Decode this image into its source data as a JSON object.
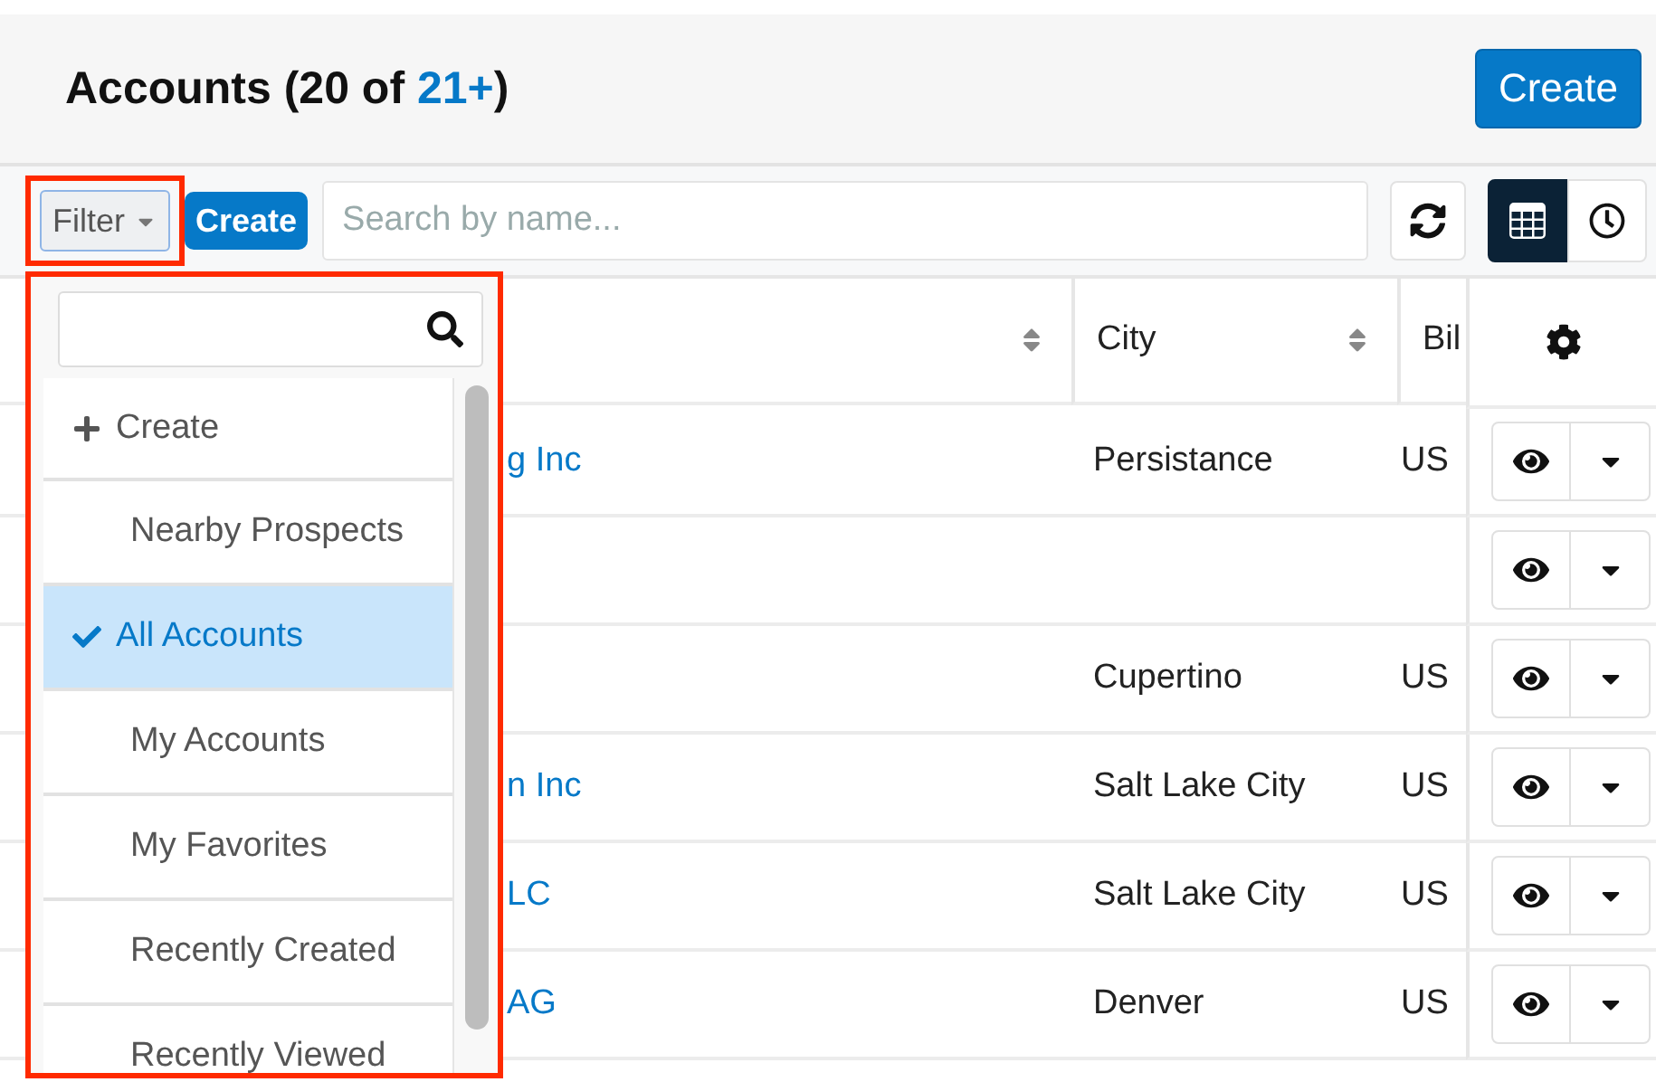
{
  "header": {
    "title_prefix": "Accounts (20 of ",
    "count_link": "21+",
    "title_suffix": ")",
    "create_button": "Create"
  },
  "toolbar": {
    "filter_button": "Filter",
    "filter_highlighted": true,
    "create_button": "Create",
    "search": {
      "placeholder": "Search by name..."
    },
    "views": [
      {
        "kind": "list",
        "selected": true
      },
      {
        "kind": "timeline",
        "selected": false
      }
    ]
  },
  "filter_menu": {
    "highlighted": true,
    "items": [
      {
        "kind": "action",
        "label": "Create",
        "selected": false
      },
      {
        "kind": "filter",
        "label": "Nearby Prospects",
        "selected": false
      },
      {
        "kind": "filter",
        "label": "All Accounts",
        "selected": true
      },
      {
        "kind": "filter",
        "label": "My Accounts",
        "selected": false
      },
      {
        "kind": "filter",
        "label": "My Favorites",
        "selected": false
      },
      {
        "kind": "filter",
        "label": "Recently Created",
        "selected": false
      },
      {
        "kind": "filter",
        "label": "Recently Viewed",
        "selected": false
      }
    ]
  },
  "table": {
    "columns": [
      {
        "sortable": true
      },
      {
        "label": "City",
        "sortable": true
      },
      {
        "label": "Bil"
      }
    ],
    "rows": [
      {
        "name": "g Inc",
        "city": "Persistance",
        "billing": "US"
      },
      {},
      {
        "city": "Cupertino",
        "billing": "US"
      },
      {
        "name": "n Inc",
        "city": "Salt Lake City",
        "billing": "US"
      },
      {
        "name": "LC",
        "city": "Salt Lake City",
        "billing": "US"
      },
      {
        "name": "AG",
        "city": "Denver",
        "billing": "US"
      }
    ]
  }
}
